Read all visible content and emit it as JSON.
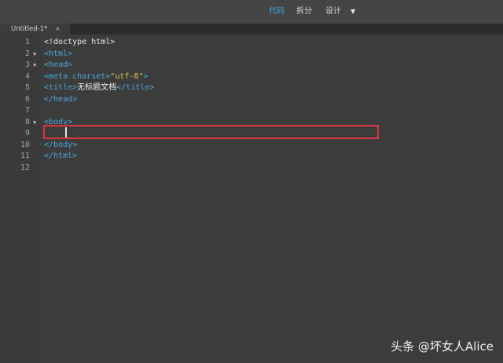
{
  "toolbar": {
    "views": [
      {
        "label": "代码",
        "active": true
      },
      {
        "label": "拆分",
        "active": false
      },
      {
        "label": "设计",
        "active": false
      }
    ],
    "dropdown_icon": "chevron-down-icon"
  },
  "document_tab": {
    "label": "Untitled-1*",
    "close_glyph": "×"
  },
  "editor": {
    "lines": [
      {
        "number": "1",
        "fold": "",
        "tokens": [
          {
            "text": "<!doctype html>",
            "kind": "plain"
          }
        ]
      },
      {
        "number": "2",
        "fold": "▼",
        "tokens": [
          {
            "text": "<html>",
            "kind": "tag"
          }
        ]
      },
      {
        "number": "3",
        "fold": "▼",
        "tokens": [
          {
            "text": "<head>",
            "kind": "tag"
          }
        ]
      },
      {
        "number": "4",
        "fold": "",
        "tokens": [
          {
            "text": "<meta ",
            "kind": "tag"
          },
          {
            "text": "charset=",
            "kind": "attr"
          },
          {
            "text": "\"utf-8\"",
            "kind": "val"
          },
          {
            "text": ">",
            "kind": "tag"
          }
        ]
      },
      {
        "number": "5",
        "fold": "",
        "tokens": [
          {
            "text": "<title>",
            "kind": "tag"
          },
          {
            "text": "无标题文档",
            "kind": "cjk"
          },
          {
            "text": "</title>",
            "kind": "tag"
          }
        ]
      },
      {
        "number": "6",
        "fold": "",
        "tokens": [
          {
            "text": "</head>",
            "kind": "tag"
          }
        ]
      },
      {
        "number": "7",
        "fold": "",
        "tokens": []
      },
      {
        "number": "8",
        "fold": "▼",
        "tokens": [
          {
            "text": "<body>",
            "kind": "tag"
          }
        ]
      },
      {
        "number": "9",
        "fold": "",
        "tokens": []
      },
      {
        "number": "10",
        "fold": "",
        "tokens": [
          {
            "text": "</body>",
            "kind": "tag"
          }
        ]
      },
      {
        "number": "11",
        "fold": "",
        "tokens": [
          {
            "text": "</html>",
            "kind": "tag"
          }
        ]
      },
      {
        "number": "12",
        "fold": "",
        "tokens": []
      }
    ],
    "highlighted_line": "9"
  },
  "watermark": {
    "text": "头条 @坏女人Alice"
  },
  "colors": {
    "accent": "#3fa7e6",
    "tag": "#4ba6d8",
    "string": "#e0c85a",
    "highlight": "#d9343e",
    "background": "#3c3c3c"
  }
}
